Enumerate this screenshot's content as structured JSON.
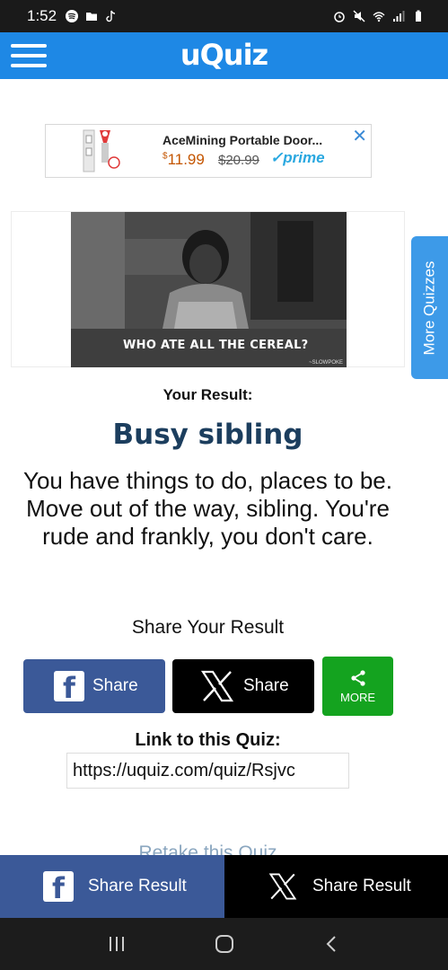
{
  "status": {
    "time": "1:52",
    "left_icons": [
      "spotify-icon",
      "folder-icon",
      "tiktok-icon"
    ],
    "right_icons": [
      "alarm-icon",
      "mute-icon",
      "wifi-icon",
      "signal-icon",
      "battery-icon"
    ]
  },
  "header": {
    "logo": "uQuiz",
    "menu_icon": "hamburger-icon"
  },
  "ad": {
    "title": "AceMining Portable Door...",
    "price_symbol": "$",
    "price": "11.99",
    "old_price": "$20.99",
    "prime": "✓prime",
    "close": "✕"
  },
  "result": {
    "image_caption": "WHO ATE ALL THE CEREAL?",
    "image_watermark": "~SLOWPOKE",
    "label": "Your Result:",
    "title": "Busy sibling",
    "description": "You have things to do, places to be. Move out of the way, sibling. You're rude and frankly, you don't care."
  },
  "side_tab": {
    "label": "More Quizzes"
  },
  "share": {
    "heading": "Share Your Result",
    "facebook_label": "Share",
    "x_label": "Share",
    "more_label": "MORE"
  },
  "link": {
    "heading": "Link to this Quiz:",
    "url": "https://uquiz.com/quiz/Rsjvc"
  },
  "retake": {
    "label": "Retake this Quiz"
  },
  "bottom_bar": {
    "facebook_label": "Share Result",
    "x_label": "Share Result"
  },
  "colors": {
    "header": "#1e88e5",
    "facebook": "#3b5998",
    "more_green": "#14a31f",
    "title_navy": "#1c3e5e"
  }
}
